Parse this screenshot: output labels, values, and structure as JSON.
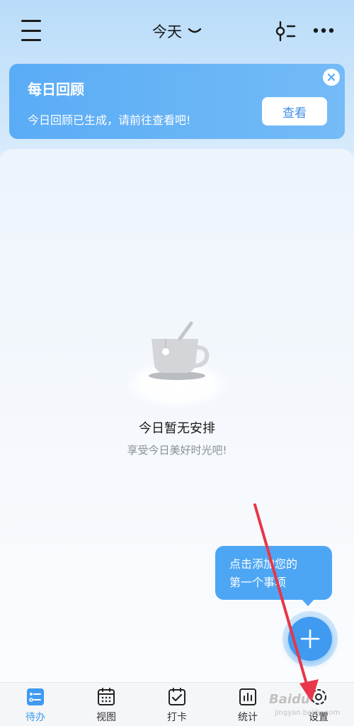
{
  "header": {
    "title": "今天"
  },
  "review_card": {
    "title": "每日回顾",
    "description": "今日回顾已生成，请前往查看吧!",
    "button_label": "查看"
  },
  "empty_state": {
    "title": "今日暂无安排",
    "subtitle": "享受今日美好时光吧!"
  },
  "tooltip": {
    "line1": "点击添加您的",
    "line2": "第一个事项"
  },
  "nav": {
    "items": [
      {
        "label": "待办",
        "icon": "todo-icon",
        "active": true
      },
      {
        "label": "视图",
        "icon": "calendar-icon",
        "active": false
      },
      {
        "label": "打卡",
        "icon": "checkin-icon",
        "active": false
      },
      {
        "label": "统计",
        "icon": "stats-icon",
        "active": false
      },
      {
        "label": "设置",
        "icon": "settings-icon",
        "active": false
      }
    ]
  },
  "watermark": {
    "brand": "Baidu",
    "sub": "jingyan.baidu.com"
  },
  "colors": {
    "accent": "#3f9af0",
    "card": "#5aacf6",
    "annotation_arrow": "#e8364a"
  }
}
